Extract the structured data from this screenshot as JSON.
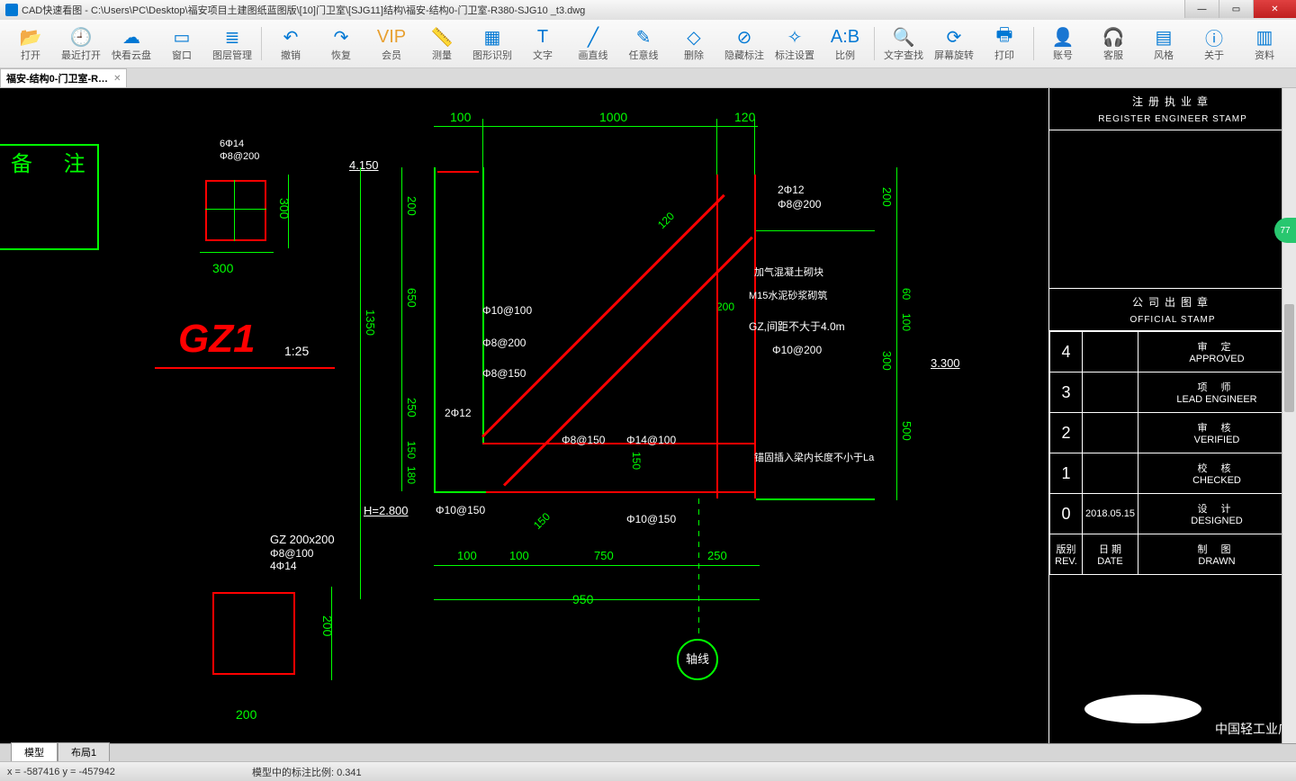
{
  "title": "CAD快速看图 - C:\\Users\\PC\\Desktop\\福安项目土建图纸蓝图版\\[10]门卫室\\[SJG11]结构\\福安-结构0-门卫室-R380-SJG10 _t3.dwg",
  "toolbar": [
    {
      "id": "open",
      "label": "打开",
      "icon": "📂"
    },
    {
      "id": "recent",
      "label": "最近打开",
      "icon": "🕘"
    },
    {
      "id": "cloud",
      "label": "快看云盘",
      "icon": "☁"
    },
    {
      "id": "window",
      "label": "窗口",
      "icon": "▭"
    },
    {
      "id": "layers",
      "label": "图层管理",
      "icon": "≣"
    },
    {
      "sep": true
    },
    {
      "id": "undo",
      "label": "撤销",
      "icon": "↶"
    },
    {
      "id": "redo",
      "label": "恢复",
      "icon": "↷"
    },
    {
      "id": "vip",
      "label": "会员",
      "icon": "VIP",
      "gold": true
    },
    {
      "id": "measure",
      "label": "测量",
      "icon": "📏"
    },
    {
      "id": "shape-rec",
      "label": "图形识别",
      "icon": "▦"
    },
    {
      "id": "text",
      "label": "文字",
      "icon": "T"
    },
    {
      "id": "line",
      "label": "画直线",
      "icon": "╱"
    },
    {
      "id": "anyline",
      "label": "任意线",
      "icon": "✎"
    },
    {
      "id": "delete",
      "label": "删除",
      "icon": "◇"
    },
    {
      "id": "hide-dim",
      "label": "隐藏标注",
      "icon": "⊘"
    },
    {
      "id": "dim-set",
      "label": "标注设置",
      "icon": "✧"
    },
    {
      "id": "scale",
      "label": "比例",
      "icon": "A:B"
    },
    {
      "sep": true
    },
    {
      "id": "find-text",
      "label": "文字查找",
      "icon": "🔍"
    },
    {
      "id": "rotate",
      "label": "屏幕旋转",
      "icon": "⟳"
    },
    {
      "id": "print",
      "label": "打印",
      "icon": "🖶"
    },
    {
      "sep": true
    },
    {
      "id": "account",
      "label": "账号",
      "icon": "👤"
    },
    {
      "id": "service",
      "label": "客服",
      "icon": "🎧"
    },
    {
      "id": "style",
      "label": "风格",
      "icon": "▤"
    },
    {
      "id": "about",
      "label": "关于",
      "icon": "ⓘ"
    },
    {
      "id": "data",
      "label": "资料",
      "icon": "▥"
    }
  ],
  "tab_name": "福安-结构0-门卫室-R…",
  "drawing": {
    "beizhu": "备  注",
    "gz1_label": "GZ1",
    "gz1_scale": "1:25",
    "gz1_dims": {
      "w": "300",
      "h": "300",
      "rebar1": "6Φ14",
      "rebar2": "Φ8@200"
    },
    "gz2_label": "GZ 200x200",
    "gz2_rebars": [
      "Φ8@100",
      "4Φ14"
    ],
    "gz2_h": "200",
    "gz2_w": "200",
    "top_dims": [
      "100",
      "1000",
      "120"
    ],
    "level_top": "4.150",
    "level_bot": "H=2.800",
    "left_dims": [
      "200",
      "650",
      "1350",
      "250",
      "150",
      "180"
    ],
    "right_level": "3.300",
    "right_dims": [
      "200",
      "60",
      "100",
      "300",
      "500"
    ],
    "bottom_dims": [
      "100",
      "100",
      "750",
      "250",
      "950",
      "150"
    ],
    "mid_dims": [
      "120",
      "200",
      "150"
    ],
    "rebars": [
      "Φ10@100",
      "Φ8@200",
      "Φ8@150",
      "2Φ12",
      "Φ8@150",
      "Φ14@100",
      "Φ10@150",
      "Φ10@150",
      "2Φ12",
      "Φ8@200",
      "Φ10@200"
    ],
    "notes": [
      "加气混凝土砌块",
      "M15水泥砂浆砌筑",
      "GZ,间距不大于4.0m",
      "锚固插入梁内长度不小于La"
    ],
    "axis": "轴线"
  },
  "stamp": {
    "reg_cn": "注册执业章",
    "reg_en": "REGISTER ENGINEER STAMP",
    "off_cn": "公司出图章",
    "off_en": "OFFICIAL STAMP",
    "rows": [
      {
        "n": "4",
        "cn": "审 定",
        "en": "APPROVED"
      },
      {
        "n": "3",
        "cn": "项 师",
        "en": "LEAD ENGINEER"
      },
      {
        "n": "2",
        "cn": "审 核",
        "en": "VERIFIED"
      },
      {
        "n": "1",
        "cn": "校 核",
        "en": "CHECKED"
      },
      {
        "n": "0",
        "d": "2018.05.15",
        "cn": "设 计",
        "en": "DESIGNED"
      }
    ],
    "foot": {
      "rev_cn": "版别",
      "rev_en": "REV.",
      "date_cn": "日 期",
      "date_en": "DATE",
      "drawn_cn": "制 图",
      "drawn_en": "DRAWN"
    },
    "company": "中国轻工业广"
  },
  "bottom_tabs": {
    "model": "模型",
    "layout": "布局1"
  },
  "status": {
    "coords": "x = -587416  y = -457942",
    "scale": "模型中的标注比例: 0.341"
  },
  "float": "77"
}
